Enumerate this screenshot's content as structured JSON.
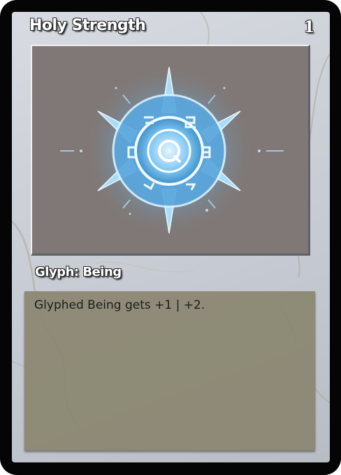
{
  "card": {
    "title": "Holy Strength",
    "cost": "1",
    "type_line": "Glyph: Being",
    "rules_text": "Glyphed Being gets +1 | +2.",
    "art": {
      "icon": "holy-glyph-sigil-icon",
      "background_color": "#807876",
      "glow_color": "#8fd3ff"
    },
    "colors": {
      "frame": "#050505",
      "face": "#cdd1d8",
      "text_box": "#8a8670"
    }
  }
}
